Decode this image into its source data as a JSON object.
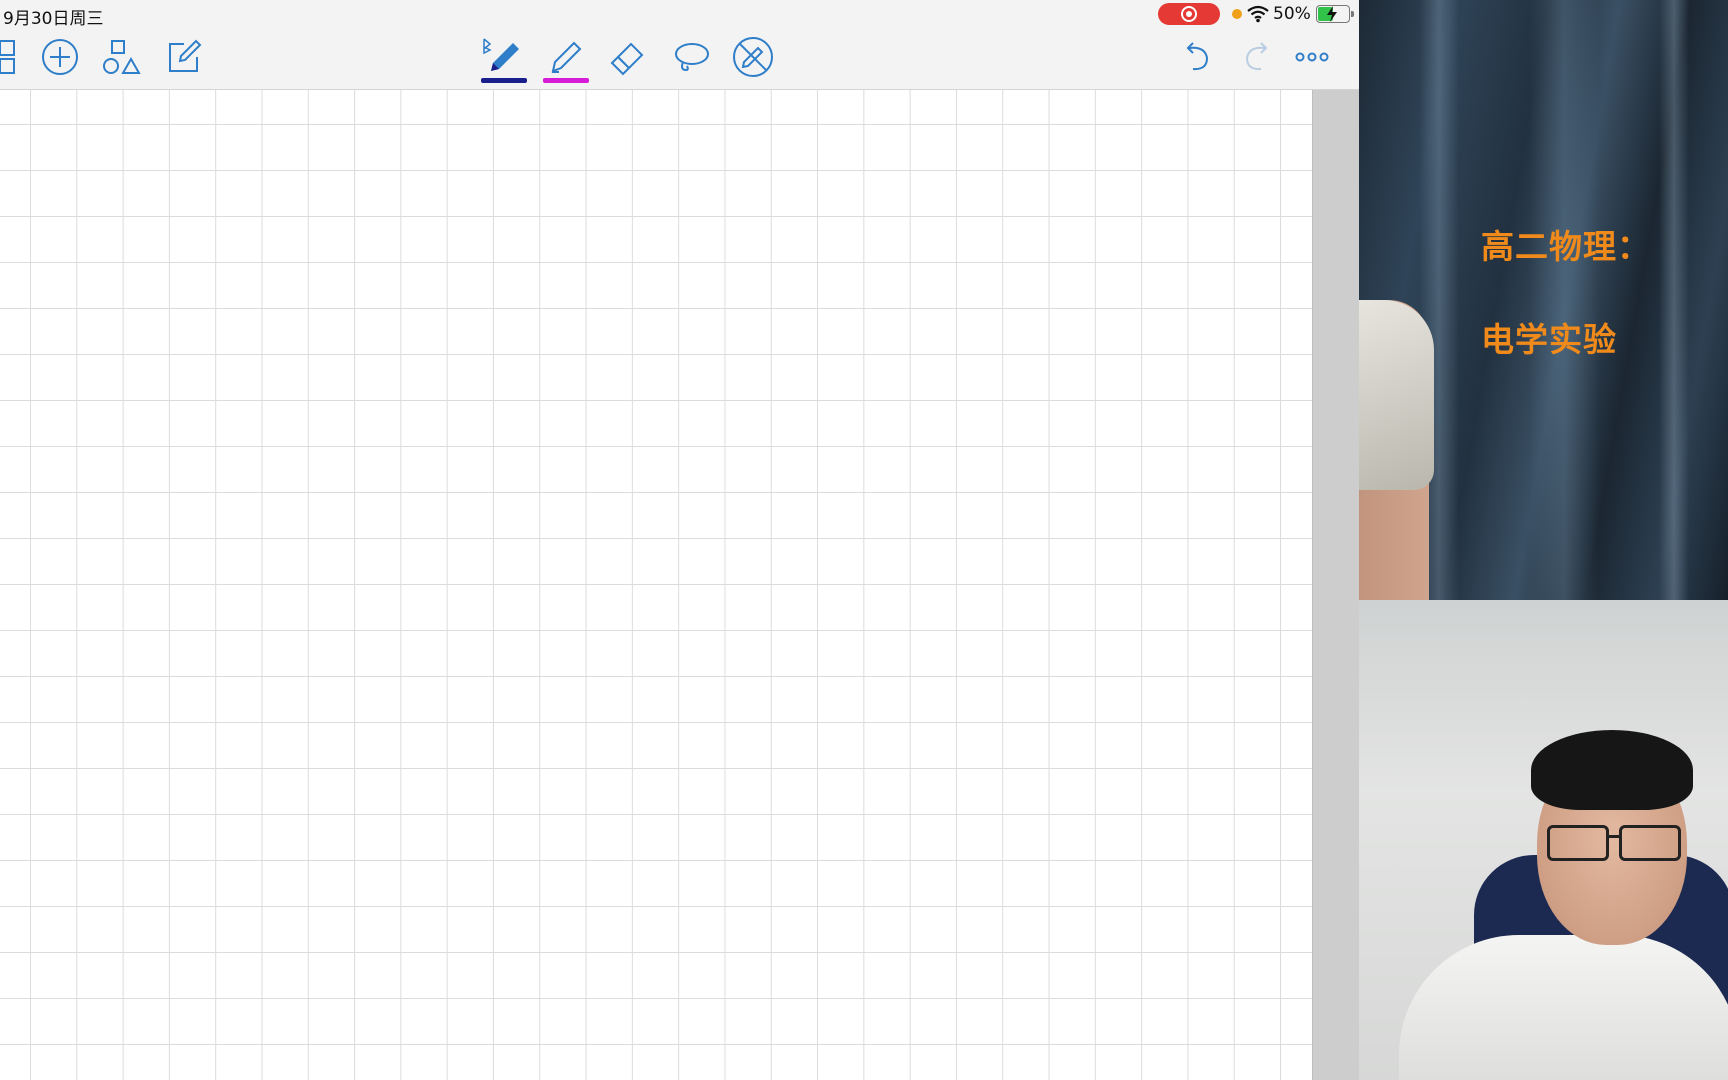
{
  "status_bar": {
    "datetime": "9月30日周三",
    "battery": "50%",
    "recording_color": "#e53935"
  },
  "toolbar": {
    "left_tools": [
      "grid-view-icon",
      "add-circle-icon",
      "shapes-icon",
      "edit-note-icon"
    ],
    "center_tools": [
      {
        "name": "pen-tool",
        "underline_color": "#1a1f8c",
        "selected": true
      },
      {
        "name": "highlighter-tool",
        "underline_color": "#d61cd6",
        "selected": false
      },
      {
        "name": "eraser-tool"
      },
      {
        "name": "lasso-tool"
      },
      {
        "name": "disable-touch-tool"
      }
    ],
    "right_tools": [
      "undo-icon",
      "redo-icon",
      "more-icon"
    ],
    "accent": "#2f7ec9"
  },
  "slide": {
    "title": "高二物理：",
    "subtitle": "电学实验",
    "text_color": "#f08a1a"
  },
  "webcam": {
    "description_free": true
  }
}
